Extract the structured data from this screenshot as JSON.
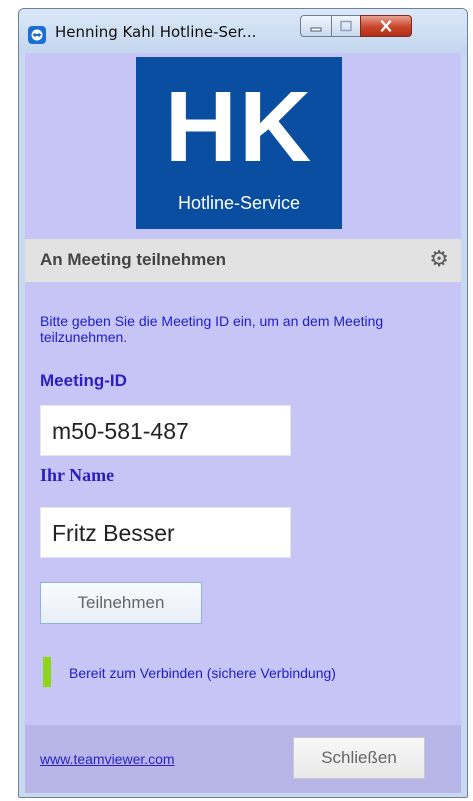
{
  "window": {
    "title": "Henning Kahl Hotline-Ser...",
    "controls": {
      "minimize_icon": "window-minimize-icon",
      "maximize_icon": "window-maximize-icon",
      "close_icon": "window-close-icon"
    }
  },
  "logo": {
    "mark": "HK",
    "subtitle": "Hotline-Service",
    "color": "#0a4ea2"
  },
  "header": {
    "title": "An Meeting teilnehmen",
    "settings_icon": "gear-icon"
  },
  "form": {
    "instruction": "Bitte geben Sie die Meeting ID ein, um an dem Meeting teilzunehmen.",
    "meeting_id_label": "Meeting-ID",
    "meeting_id_value": "m50-581-487",
    "name_label": "Ihr Name",
    "name_value": "Fritz Besser",
    "join_button": "Teilnehmen"
  },
  "status": {
    "text": "Bereit zum Verbinden (sichere Verbindung)",
    "indicator_color": "#8ed61a"
  },
  "footer": {
    "link": "www.teamviewer.com",
    "close_button": "Schließen"
  },
  "colors": {
    "background": "#c7c5f5",
    "accent_text": "#2a1fbf"
  }
}
